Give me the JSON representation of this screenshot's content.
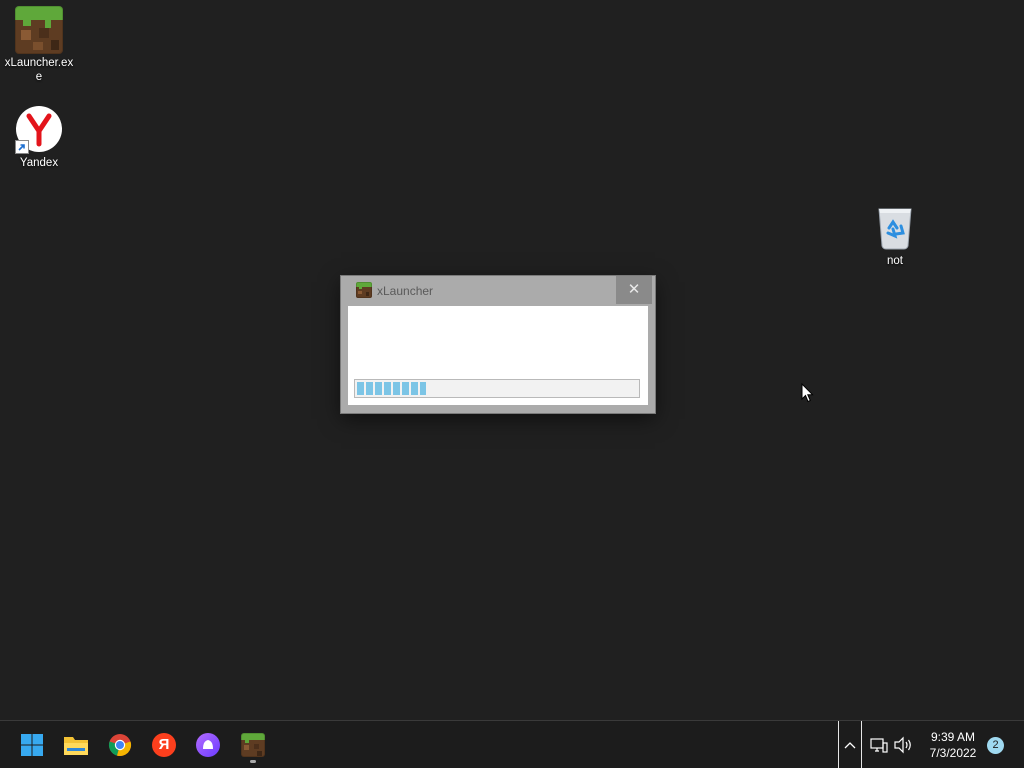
{
  "desktop": {
    "icons": [
      {
        "label": "xLauncher.exe",
        "icon": "minecraft-grass-block-icon"
      },
      {
        "label": "Yandex",
        "icon": "yandex-browser-icon"
      },
      {
        "label": "not",
        "icon": "recycle-bin-icon"
      }
    ]
  },
  "launcher_window": {
    "title": "xLauncher",
    "close_glyph": "✕",
    "progress_percent": 25
  },
  "taskbar": {
    "apps": [
      {
        "name": "Start",
        "icon": "windows-start-icon"
      },
      {
        "name": "File Explorer",
        "icon": "file-explorer-icon"
      },
      {
        "name": "Chrome",
        "icon": "chrome-icon"
      },
      {
        "name": "Yandex",
        "icon": "yandex-icon",
        "glyph": "Я"
      },
      {
        "name": "Alice",
        "icon": "alice-icon"
      },
      {
        "name": "xLauncher",
        "icon": "minecraft-grass-block-icon",
        "running": true
      }
    ],
    "tray": {
      "time": "9:39 AM",
      "date": "7/3/2022",
      "notification_count": "2"
    }
  },
  "colors": {
    "desktop_bg": "#202020",
    "taskbar_bg": "#1c1c1c",
    "progress_fill": "#7cc5e6",
    "window_frame": "#ababab"
  }
}
